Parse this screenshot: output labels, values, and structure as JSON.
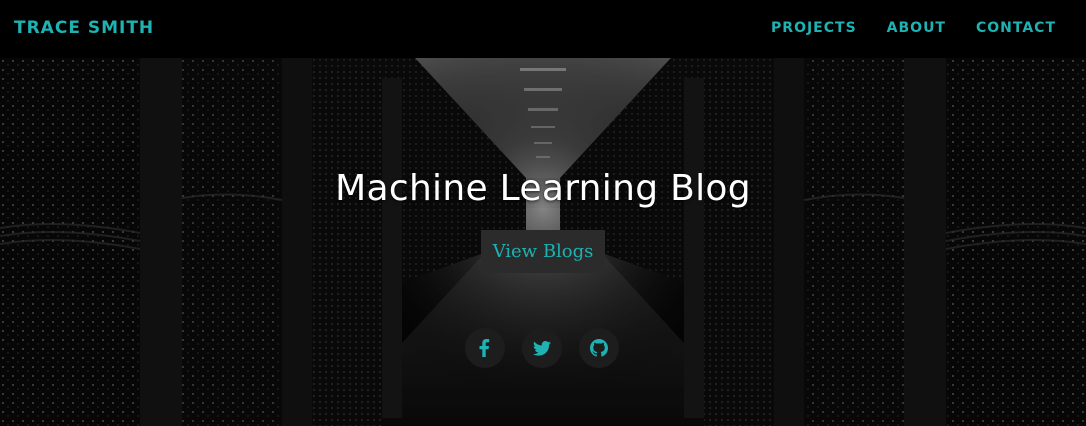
{
  "nav": {
    "brand": "TRACE SMITH",
    "links": [
      "PROJECTS",
      "ABOUT",
      "CONTACT"
    ]
  },
  "hero": {
    "title": "Machine Learning Blog",
    "button_label": "View Blogs"
  },
  "social": {
    "icons": [
      "facebook-icon",
      "twitter-icon",
      "github-icon"
    ]
  },
  "colors": {
    "accent": "#1eb2b2",
    "navbar_bg": "#000000",
    "button_bg": "#2b2b2b",
    "title_text": "#ffffff"
  }
}
